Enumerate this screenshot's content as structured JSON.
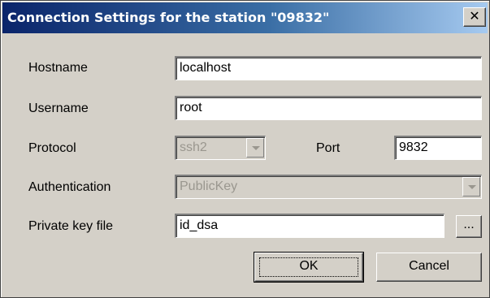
{
  "dialog": {
    "title": "Connection Settings for the station \"09832\"",
    "close_glyph": "✕"
  },
  "fields": {
    "hostname": {
      "label": "Hostname",
      "value": "localhost"
    },
    "username": {
      "label": "Username",
      "value": "root"
    },
    "protocol": {
      "label": "Protocol",
      "value": "ssh2"
    },
    "port": {
      "label": "Port",
      "value": "9832"
    },
    "authentication": {
      "label": "Authentication",
      "value": "PublicKey"
    },
    "private_key_file": {
      "label": "Private key file",
      "value": "id_dsa",
      "browse_label": "..."
    }
  },
  "buttons": {
    "ok": "OK",
    "cancel": "Cancel"
  },
  "colors": {
    "titlebar_start": "#0a246a",
    "titlebar_end": "#a6caf0",
    "face": "#d4d0c8",
    "disabled_text": "#9a978f"
  },
  "icons": {
    "close": "close-icon",
    "dropdown": "chevron-down-icon"
  }
}
